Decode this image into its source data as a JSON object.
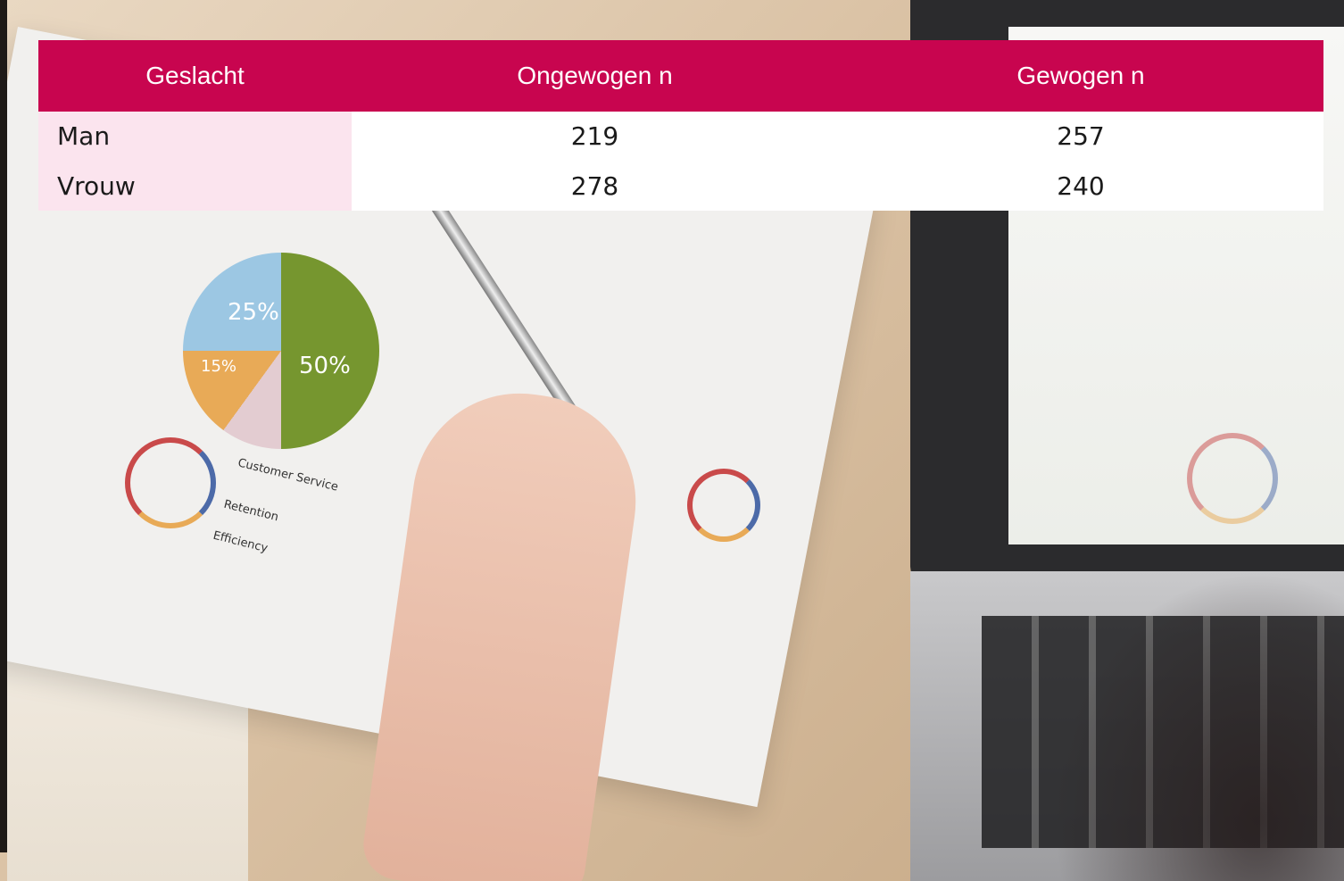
{
  "table": {
    "headers": [
      "Geslacht",
      "Ongewogen n",
      "Gewogen n"
    ],
    "rows": [
      [
        "Man",
        "219",
        "257"
      ],
      [
        "Vrouw",
        "278",
        "240"
      ]
    ]
  },
  "background_photo": {
    "pie_labels": [
      "25%",
      "15%",
      "50%"
    ],
    "legend_labels": [
      "Customer Service",
      "Retention",
      "Efficiency"
    ]
  },
  "colors": {
    "header_bg": "#c8054f",
    "header_text": "#ffffff",
    "first_column_bg": "#fbe4ee",
    "body_bg": "#ffffff"
  }
}
